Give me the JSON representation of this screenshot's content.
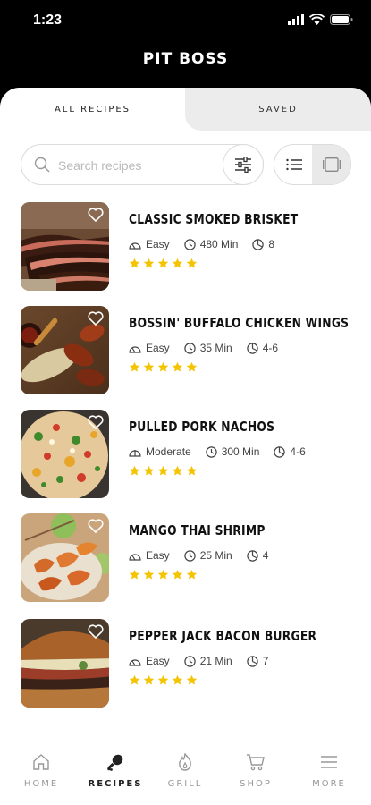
{
  "status_bar": {
    "time": "1:23"
  },
  "header": {
    "brand": "PIT BOSS"
  },
  "tabs": {
    "all_recipes": "ALL RECIPES",
    "saved": "SAVED"
  },
  "search": {
    "placeholder": "Search recipes"
  },
  "recipes": [
    {
      "title": "CLASSIC SMOKED BRISKET",
      "difficulty": "Easy",
      "time": "480 Min",
      "servings": "8",
      "stars": 5,
      "image": "brisket"
    },
    {
      "title": "BOSSIN' BUFFALO CHICKEN WINGS",
      "difficulty": "Easy",
      "time": "35 Min",
      "servings": "4-6",
      "stars": 5,
      "image": "wings"
    },
    {
      "title": "PULLED PORK NACHOS",
      "difficulty": "Moderate",
      "time": "300 Min",
      "servings": "4-6",
      "stars": 5,
      "image": "nachos"
    },
    {
      "title": "MANGO THAI SHRIMP",
      "difficulty": "Easy",
      "time": "25 Min",
      "servings": "4",
      "stars": 5,
      "image": "shrimp"
    },
    {
      "title": "PEPPER JACK BACON BURGER",
      "difficulty": "Easy",
      "time": "21 Min",
      "servings": "7",
      "stars": 5,
      "image": "burger"
    }
  ],
  "bottom_nav": {
    "home": "HOME",
    "recipes": "RECIPES",
    "grill": "GRILL",
    "shop": "SHOP",
    "more": "MORE"
  },
  "colors": {
    "star": "#f5c400",
    "accent": "#000000"
  }
}
